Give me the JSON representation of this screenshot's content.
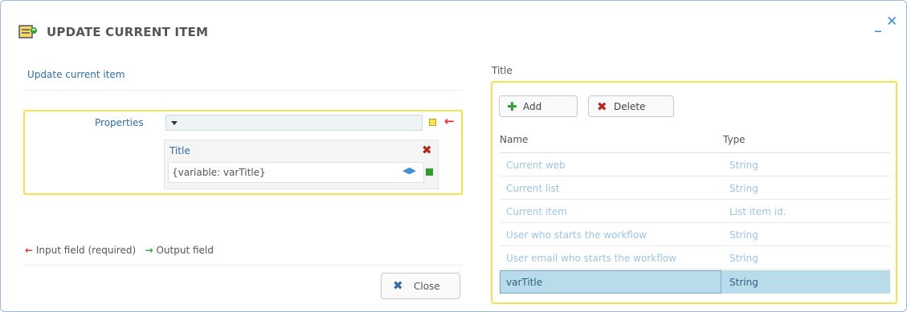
{
  "dialog": {
    "title": "UPDATE CURRENT ITEM",
    "minimize": "_",
    "close": "✕"
  },
  "left": {
    "section_label": "Update current item",
    "properties_label": "Properties",
    "select_value": "",
    "sub_title": "Title",
    "sub_value": "{variable: varTitle}",
    "legend": {
      "input_arrow": "←",
      "input_label": "Input field (required)",
      "output_arrow": "→",
      "output_label": "Output field"
    },
    "close_label": "Close"
  },
  "right": {
    "title": "Title",
    "add_label": "Add",
    "delete_label": "Delete",
    "columns": {
      "name": "Name",
      "type": "Type"
    },
    "rows": [
      {
        "name": "Current web",
        "type": "String"
      },
      {
        "name": "Current list",
        "type": "String"
      },
      {
        "name": "Current item",
        "type": "List item id."
      },
      {
        "name": "User who starts the workflow",
        "type": "String"
      },
      {
        "name": "User email who starts the workflow",
        "type": "String"
      },
      {
        "name": "varTitle",
        "type": "String"
      }
    ],
    "selected_index": 5
  },
  "colors": {
    "accent_blue": "#2f6da6",
    "highlight_yellow": "#f2e44f",
    "required_red": "#dd3333",
    "output_green": "#2f9e2f",
    "selected_row": "#b9dcea"
  },
  "icons": [
    "workflow-icon",
    "minimize-icon",
    "close-window-icon",
    "dropdown-caret-icon",
    "required-square-icon",
    "input-arrow-icon",
    "delete-x-icon",
    "bidirectional-arrow-icon",
    "output-square-icon",
    "add-plus-icon",
    "delete-icon",
    "close-x-icon"
  ]
}
